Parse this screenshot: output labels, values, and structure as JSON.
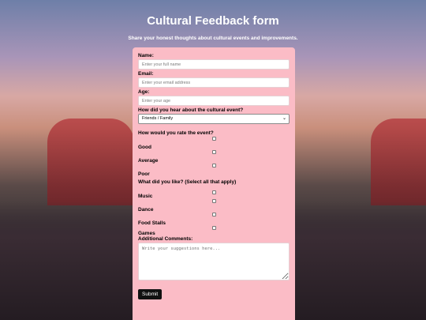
{
  "page": {
    "title": "Cultural Feedback form",
    "subtitle": "Share your honest thoughts about cultural events and improvements."
  },
  "form": {
    "name_label": "Name:",
    "name_placeholder": "Enter your full name",
    "email_label": "Email:",
    "email_placeholder": "Enter your email address",
    "age_label": "Age:",
    "age_placeholder": "Enter your age",
    "source_label": "How did you hear about the cultural event?",
    "source_selected": "Friends / Family",
    "rating_label": "How would you rate the event?",
    "rating_options": [
      "Good",
      "Average",
      "Poor"
    ],
    "likes_label": "What did you like? (Select all that apply)",
    "likes_options": [
      "Music",
      "Dance",
      "Food Stalls",
      "Games"
    ],
    "comments_label": "Additional Comments:",
    "comments_placeholder": "Write your suggestions here...",
    "submit_label": "Submit"
  },
  "colors": {
    "form_background": "#fbbcc6",
    "submit_background": "#111111"
  }
}
